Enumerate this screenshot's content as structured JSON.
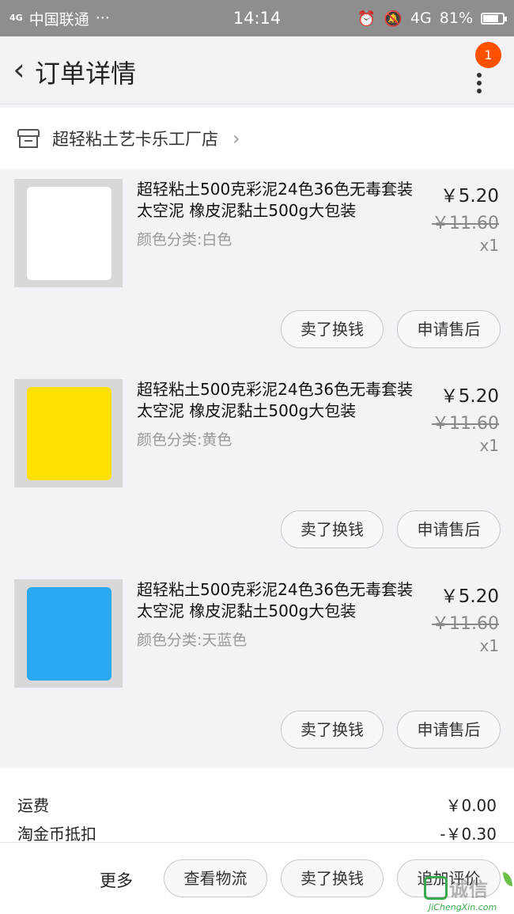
{
  "status_bar": {
    "signal": "4G",
    "carrier": "中国联通",
    "ellipsis": "···",
    "time": "14:14",
    "network": "4G",
    "battery": "81%",
    "battery_level": 0.81
  },
  "header": {
    "title": "订单详情",
    "notification_count": "1"
  },
  "shop": {
    "name": "超轻粘土艺卡乐工厂店"
  },
  "items": [
    {
      "name": "超轻粘土500克彩泥24色36色无毒套装太空泥 橡皮泥黏土500g大包装",
      "sku": "颜色分类:白色",
      "price": "￥5.20",
      "original_price": "￥11.60",
      "quantity": "x1",
      "color": "#ffffff",
      "button_sell": "卖了换钱",
      "button_aftersale": "申请售后"
    },
    {
      "name": "超轻粘土500克彩泥24色36色无毒套装太空泥 橡皮泥黏土500g大包装",
      "sku": "颜色分类:黄色",
      "price": "￥5.20",
      "original_price": "￥11.60",
      "quantity": "x1",
      "color": "#ffe000",
      "button_sell": "卖了换钱",
      "button_aftersale": "申请售后"
    },
    {
      "name": "超轻粘土500克彩泥24色36色无毒套装太空泥 橡皮泥黏土500g大包装",
      "sku": "颜色分类:天蓝色",
      "price": "￥5.20",
      "original_price": "￥11.60",
      "quantity": "x1",
      "color": "#2aa8f2",
      "button_sell": "卖了换钱",
      "button_aftersale": "申请售后"
    }
  ],
  "summary": {
    "shipping_label": "运费",
    "shipping_value": "￥0.00",
    "coin_label": "淘金币抵扣",
    "coin_value": "-￥0.30"
  },
  "bottom_bar": {
    "more": "更多",
    "logistics": "查看物流",
    "sell": "卖了换钱",
    "review": "追加评价"
  },
  "watermark": {
    "text": "诚信",
    "sub": "JiChengXin.com"
  },
  "colors": {
    "accent": "#ff5000",
    "background": "#f4f2f7"
  }
}
